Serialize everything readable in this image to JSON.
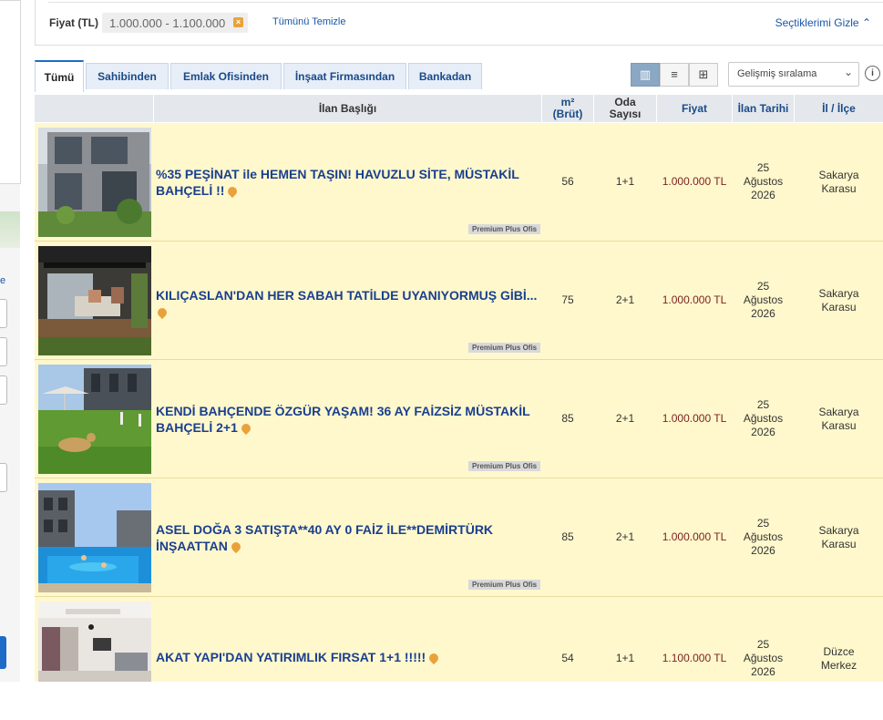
{
  "filter": {
    "price_label": "Fiyat (TL)",
    "price_value": "1.000.000 - 1.100.000",
    "close_glyph": "×",
    "clear_all": "Tümünü Temizle",
    "hide_selected": "Seçtiklerimi Gizle ⌃"
  },
  "sidebar_fragment": {
    "letter": "e"
  },
  "tabs": [
    {
      "label": "Tümü",
      "active": true
    },
    {
      "label": "Sahibinden",
      "active": false
    },
    {
      "label": "Emlak Ofisinden",
      "active": false
    },
    {
      "label": "İnşaat Firmasından",
      "active": false
    },
    {
      "label": "Bankadan",
      "active": false
    }
  ],
  "views": [
    {
      "icon": "gallery-view-icon",
      "glyph": "▥",
      "active": true
    },
    {
      "icon": "list-view-icon",
      "glyph": "≡",
      "active": false
    },
    {
      "icon": "grid-view-icon",
      "glyph": "⊞",
      "active": false
    }
  ],
  "sort": {
    "selected": "Gelişmiş sıralama",
    "chevron": "⌄",
    "info": "i"
  },
  "table": {
    "headers": {
      "title": "İlan Başlığı",
      "m2": "m²",
      "m2_sub": "(Brüt)",
      "rooms": "Oda",
      "rooms_sub": "Sayısı",
      "price": "Fiyat",
      "date": "İlan Tarihi",
      "location": "İl / İlçe"
    },
    "rows": [
      {
        "title": "%35 PEŞİNAT ile HEMEN TAŞIN! HAVUZLU SİTE, MÜSTAKİL BAHÇELİ !!",
        "badge": "Premium Plus Ofis",
        "m2": "56",
        "rooms": "1+1",
        "price": "1.000.000 TL",
        "date_day": "25",
        "date_month": "Ağustos",
        "date_year": "2026",
        "city": "Sakarya",
        "district": "Karasu"
      },
      {
        "title": "KILIÇASLAN'DAN HER SABAH TATİLDE UYANIYORMUŞ GİBİ...",
        "badge": "Premium Plus Ofis",
        "m2": "75",
        "rooms": "2+1",
        "price": "1.000.000 TL",
        "date_day": "25",
        "date_month": "Ağustos",
        "date_year": "2026",
        "city": "Sakarya",
        "district": "Karasu"
      },
      {
        "title": "KENDİ BAHÇENDE ÖZGÜR YAŞAM! 36 AY FAİZSİZ MÜSTAKİL BAHÇELİ 2+1",
        "badge": "Premium Plus Ofis",
        "m2": "85",
        "rooms": "2+1",
        "price": "1.000.000 TL",
        "date_day": "25",
        "date_month": "Ağustos",
        "date_year": "2026",
        "city": "Sakarya",
        "district": "Karasu"
      },
      {
        "title": "ASEL DOĞA 3 SATIŞTA**40 AY 0 FAİZ İLE**DEMİRTÜRK İNŞAATTAN",
        "badge": "Premium Plus Ofis",
        "m2": "85",
        "rooms": "2+1",
        "price": "1.000.000 TL",
        "date_day": "25",
        "date_month": "Ağustos",
        "date_year": "2026",
        "city": "Sakarya",
        "district": "Karasu"
      },
      {
        "title": "AKAT YAPI'DAN YATIRIMLIK FIRSAT 1+1 !!!!!",
        "badge": "",
        "m2": "54",
        "rooms": "1+1",
        "price": "1.100.000 TL",
        "date_day": "25",
        "date_month": "Ağustos",
        "date_year": "2026",
        "city": "Düzce",
        "district": "Merkez"
      }
    ]
  }
}
